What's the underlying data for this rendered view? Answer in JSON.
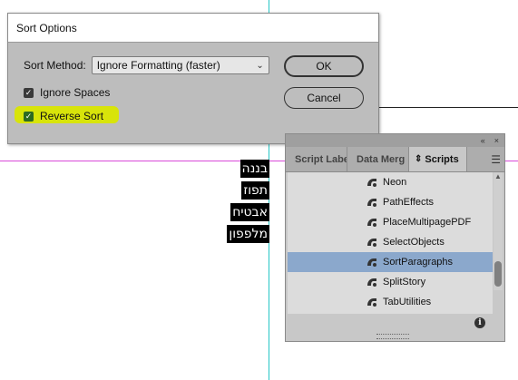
{
  "dialog": {
    "title": "Sort Options",
    "sort_method_label": "Sort Method:",
    "sort_method_value": "Ignore Formatting (faster)",
    "ignore_spaces_label": "Ignore Spaces",
    "ignore_spaces_checked": true,
    "reverse_sort_label": "Reverse Sort",
    "reverse_sort_checked": true,
    "ok_label": "OK",
    "cancel_label": "Cancel",
    "highlight_color": "#d9e600"
  },
  "document": {
    "hebrew_lines": [
      "בננה",
      "תפוז",
      "אבטיח",
      "מלפפון"
    ]
  },
  "panel": {
    "tabs": [
      "Script Labe",
      "Data Merg",
      "Scripts"
    ],
    "active_tab": "Scripts",
    "active_tab_icon": "⇕",
    "top_controls": [
      "«",
      "×"
    ],
    "scripts": [
      "Neon",
      "PathEffects",
      "PlaceMultipagePDF",
      "SelectObjects",
      "SortParagraphs",
      "SplitStory",
      "TabUtilities"
    ],
    "selected_script": "SortParagraphs",
    "selected_color": "#8ba8cc",
    "info_icon": "i"
  }
}
